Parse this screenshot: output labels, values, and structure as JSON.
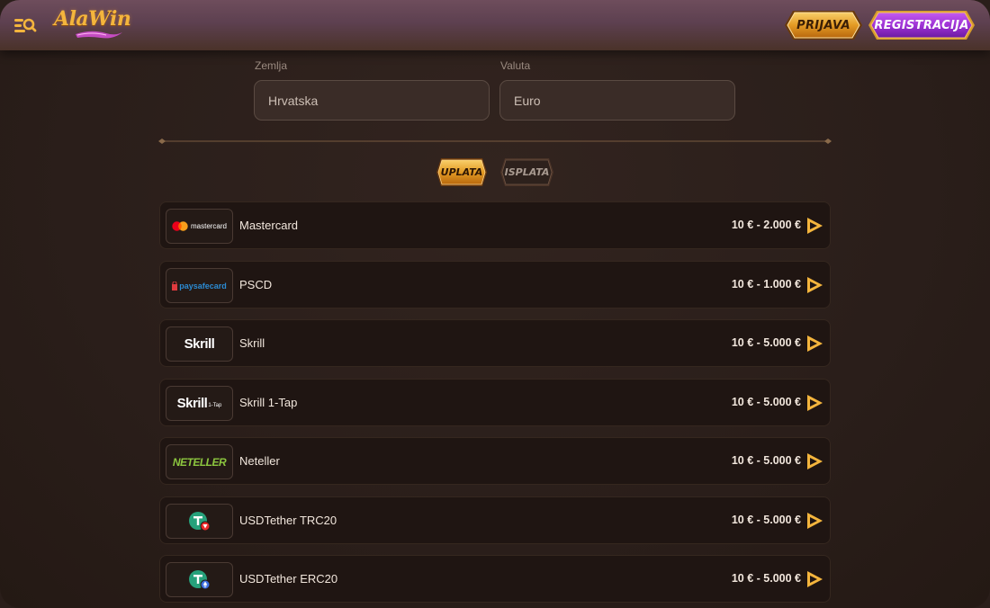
{
  "header": {
    "logo_text": "AlaWin",
    "login_label": "PRIJAVA",
    "register_label": "REGISTRACIJA"
  },
  "filters": {
    "country_label": "Zemlja",
    "country_value": "Hrvatska",
    "currency_label": "Valuta",
    "currency_value": "Euro"
  },
  "tabs": {
    "deposit_label": "UPLATA",
    "withdraw_label": "ISPLATA",
    "active": "deposit"
  },
  "methods": [
    {
      "name": "Mastercard",
      "limit": "10 € - 2.000 €",
      "logo": "mastercard",
      "logo_text": "mastercard"
    },
    {
      "name": "PSCD",
      "limit": "10 € - 1.000 €",
      "logo": "paysafecard",
      "logo_text": "paysafecard"
    },
    {
      "name": "Skrill",
      "limit": "10 € - 5.000 €",
      "logo": "skrill",
      "logo_text": "Skrill"
    },
    {
      "name": "Skrill 1-Tap",
      "limit": "10 € - 5.000 €",
      "logo": "skrill-1tap",
      "logo_text": "Skrill",
      "logo_sub": "1-Tap"
    },
    {
      "name": "Neteller",
      "limit": "10 € - 5.000 €",
      "logo": "neteller",
      "logo_text": "NETELLER"
    },
    {
      "name": "USDTether TRC20",
      "limit": "10 € - 5.000 €",
      "logo": "tether-trc20-icon"
    },
    {
      "name": "USDTether ERC20",
      "limit": "10 € - 5.000 €",
      "logo": "tether-erc20-icon"
    }
  ],
  "colors": {
    "accent_gold": "#f4b53d",
    "register_purple": "#a23bd6",
    "background": "#2a1e1a"
  }
}
